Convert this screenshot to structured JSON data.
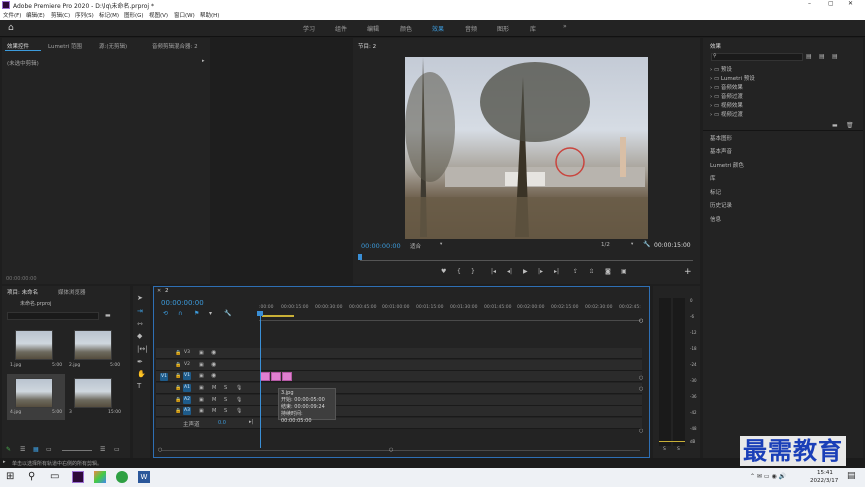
{
  "window": {
    "title": "Adobe Premiere Pro 2020 - D:\\lq\\未命名.prproj *",
    "controls": [
      "–",
      "▢",
      "✕"
    ]
  },
  "menu": [
    "文件(F)",
    "编辑(E)",
    "剪辑(C)",
    "序列(S)",
    "标记(M)",
    "图形(G)",
    "视图(V)",
    "窗口(W)",
    "帮助(H)"
  ],
  "workspaces": [
    "学习",
    "组件",
    "编辑",
    "颜色",
    "效果",
    "音频",
    "图形",
    "库"
  ],
  "active_workspace": "效果",
  "more_workspaces": "»",
  "source_panel": {
    "tabs": [
      "效果控件",
      "Lumetri 范围",
      "源:(无剪辑)",
      "音频剪辑混合器: 2"
    ],
    "message": "(未选中剪辑)",
    "timecode": "00:00:00:00"
  },
  "program_panel": {
    "tab": "节目: 2",
    "timecode_current": "00:00:00:00",
    "fit": "适合",
    "resolution": "1/2",
    "timecode_total": "00:00:15:00"
  },
  "effects_panel": {
    "title": "效果",
    "search_placeholder": "",
    "folders": [
      "预设",
      "Lumetri 预设",
      "音频效果",
      "音频过渡",
      "视频效果",
      "视频过渡"
    ],
    "sections": [
      "基本图形",
      "基本声音",
      "Lumetri 颜色",
      "库",
      "标记",
      "历史记录",
      "信息"
    ]
  },
  "project_panel": {
    "tabs": [
      "项目: 未命名",
      "媒体浏览器"
    ],
    "file": "未命名.prproj",
    "items": [
      {
        "name": "1.jpg",
        "duration": "5:00"
      },
      {
        "name": "2.jpg",
        "duration": "5:00"
      },
      {
        "name": "4.jpg",
        "duration": "5:00"
      },
      {
        "name": "3",
        "duration": "15:00"
      }
    ]
  },
  "timeline": {
    "tab": "2",
    "timecode": "00:00:00:00",
    "ruler": [
      ":00:00",
      "00:00:15:00",
      "00:00:30:00",
      "00:00:45:00",
      "00:01:00:00",
      "00:01:15:00",
      "00:01:30:00",
      "00:01:45:00",
      "00:02:00:00",
      "00:02:15:00",
      "00:02:30:00",
      "00:02:45:"
    ],
    "video_tracks": [
      "V3",
      "V2",
      "V1"
    ],
    "audio_tracks": [
      "A1",
      "A2",
      "A3"
    ],
    "source_patch_v": "V1",
    "master": "主声道",
    "master_value": "0.0",
    "track_buttons": {
      "mute": "M",
      "solo": "S"
    },
    "tooltip": {
      "name": "3.jpg",
      "start": "开始: 00:00:05:00",
      "end": "结束: 00:00:09:24",
      "duration": "持续时间: 00:00:05:00"
    }
  },
  "audio_meter": {
    "scale": [
      "0",
      "-6",
      "-12",
      "-18",
      "-24",
      "-30",
      "-36",
      "-42",
      "-48",
      "dB"
    ],
    "channels": [
      "S",
      "S"
    ]
  },
  "status_bar": "单击以选择所有轨道中右侧的所有剪辑。",
  "watermark": "最需教育",
  "taskbar": {
    "time": "15:41",
    "date": "2022/3/17"
  },
  "colors": {
    "accent": "#3c9bdc",
    "clip": "#e07fd0",
    "playhead": "#3a8fd6"
  }
}
